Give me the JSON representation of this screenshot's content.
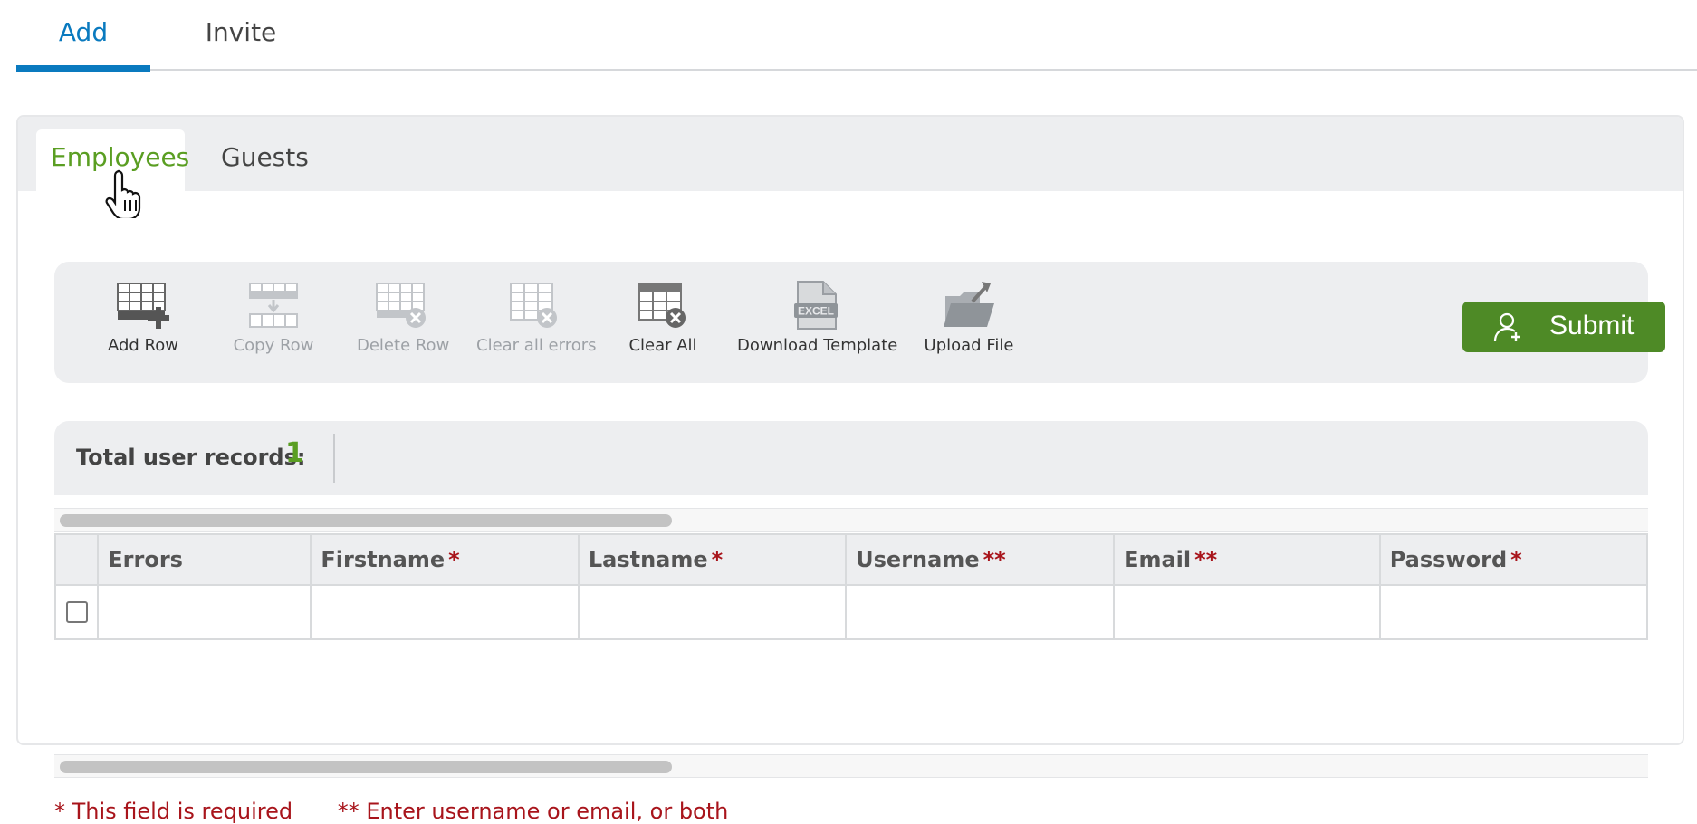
{
  "top_tabs": [
    {
      "label": "Add",
      "active": true
    },
    {
      "label": "Invite",
      "active": false
    }
  ],
  "sub_tabs": [
    {
      "label": "Employees",
      "active": true
    },
    {
      "label": "Guests",
      "active": false
    }
  ],
  "toolbar": {
    "add_row": "Add Row",
    "copy_row": "Copy Row",
    "delete_row": "Delete Row",
    "clear_errors": "Clear all errors",
    "clear_all": "Clear All",
    "download_template": "Download Template",
    "upload_file": "Upload File",
    "excel_badge": "EXCEL",
    "submit": "Submit"
  },
  "records": {
    "label": "Total user records:",
    "count": "1"
  },
  "grid": {
    "columns": [
      {
        "label": "Errors",
        "marker": ""
      },
      {
        "label": "Firstname",
        "marker": "*"
      },
      {
        "label": "Lastname",
        "marker": "*"
      },
      {
        "label": "Username",
        "marker": "**"
      },
      {
        "label": "Email",
        "marker": "**"
      },
      {
        "label": "Password",
        "marker": "*"
      }
    ]
  },
  "notes": {
    "required": "* This field is required",
    "either": "** Enter username or email, or both"
  },
  "colors": {
    "accent_blue": "#0a7abf",
    "accent_green": "#5a9e22",
    "submit_green": "#4e8a26",
    "required_red": "#a8141b"
  },
  "icons": [
    "add-row-icon",
    "copy-row-icon",
    "delete-row-icon",
    "clear-errors-icon",
    "clear-all-icon",
    "excel-file-icon",
    "upload-folder-icon",
    "add-user-icon",
    "hand-cursor-icon"
  ]
}
